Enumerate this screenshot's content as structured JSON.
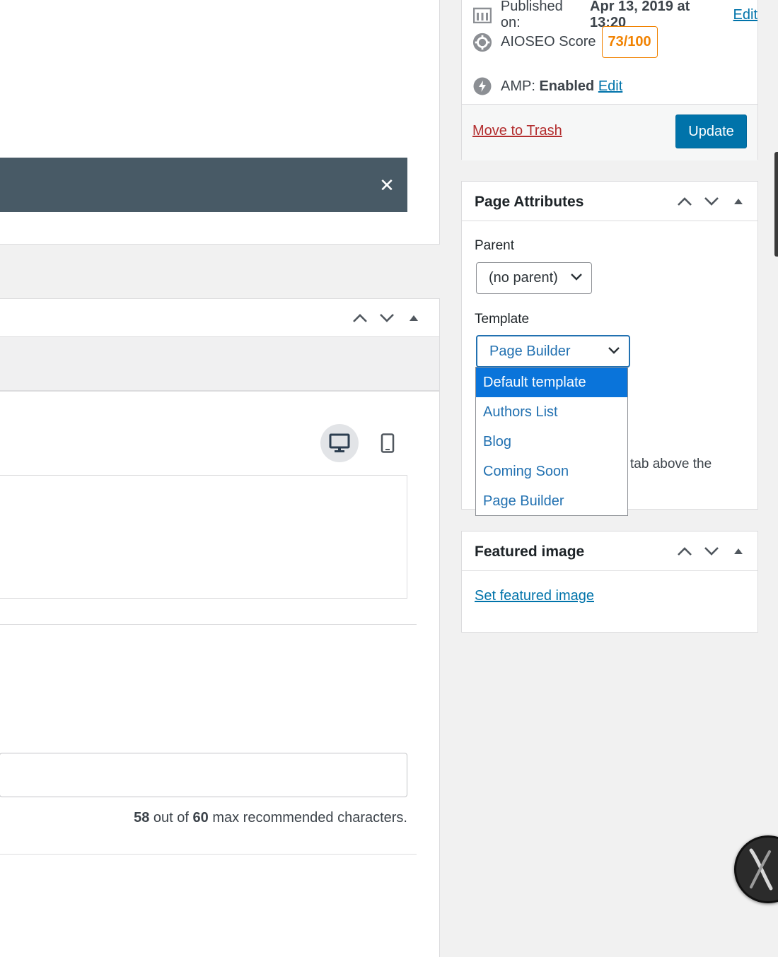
{
  "publish": {
    "published_label": "Published on:",
    "published_date": "Apr 13, 2019 at 13:20",
    "published_edit": "Edit",
    "aioseo_label": "AIOSEO Score",
    "aioseo_score": "73/100",
    "amp_label": "AMP:",
    "amp_value": "Enabled",
    "amp_edit": "Edit",
    "trash_label": "Move to Trash",
    "update_label": "Update"
  },
  "notice": {
    "close_glyph": "✕"
  },
  "seo": {
    "char_count": "58",
    "char_mid": "out of",
    "char_max": "60",
    "char_suffix": "max recommended characters."
  },
  "page_attributes": {
    "title": "Page Attributes",
    "parent_label": "Parent",
    "parent_value": "(no parent)",
    "template_label": "Template",
    "template_value": "Page Builder",
    "help_text_fragment": "tab above the",
    "template_options": [
      "Default template",
      "Authors List",
      "Blog",
      "Coming Soon",
      "Page Builder"
    ],
    "highlighted_option": "Default template"
  },
  "featured_image": {
    "title": "Featured image",
    "set_link": "Set featured image"
  },
  "colors": {
    "accent": "#0073aa",
    "notice_bg": "#485a66",
    "score_orange": "#f18200",
    "trash_red": "#b32d2e",
    "dropdown_highlight": "#0a74da"
  }
}
